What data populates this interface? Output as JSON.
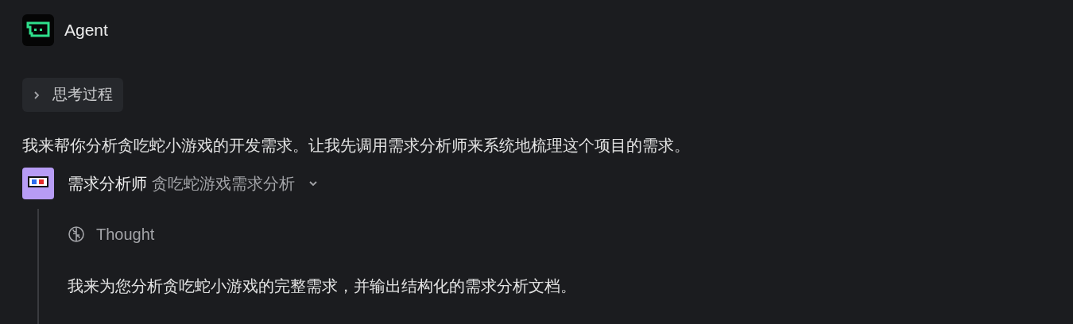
{
  "agent": {
    "name": "Agent"
  },
  "thinking": {
    "label": "思考过程",
    "expanded": false
  },
  "message": "我来帮你分析贪吃蛇小游戏的开发需求。让我先调用需求分析师来系统地梳理这个项目的需求。",
  "subagent": {
    "name": "需求分析师",
    "task": "贪吃蛇游戏需求分析",
    "expanded": true,
    "thought": {
      "label": "Thought"
    },
    "text": "我来为您分析贪吃蛇小游戏的完整需求，并输出结构化的需求分析文档。"
  }
}
